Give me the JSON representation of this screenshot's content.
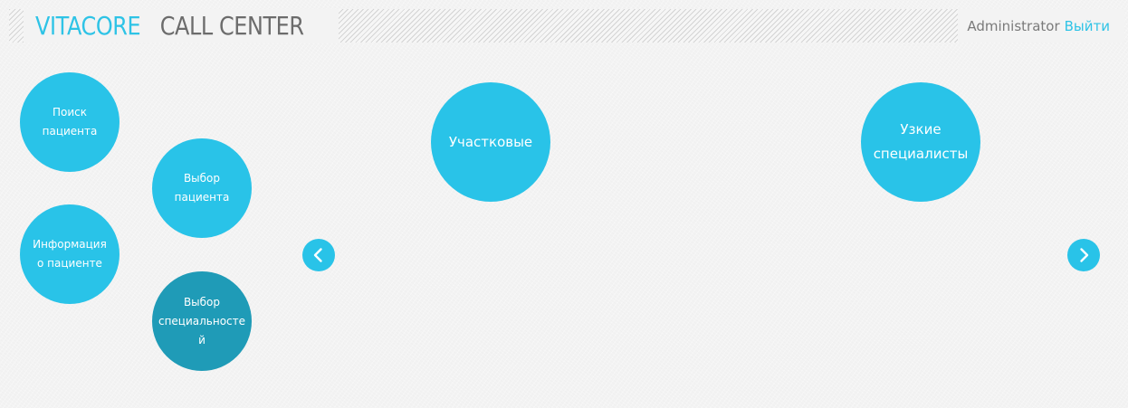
{
  "header": {
    "logo_accent": "VITACORE",
    "logo_main": "CALL CENTER",
    "user_name": "Administrator",
    "logout_label": "Выйти"
  },
  "menu": {
    "items": [
      {
        "line1": "Поиск",
        "line2": "пациента"
      },
      {
        "line1": "Выбор",
        "line2": "пациента"
      },
      {
        "line1": "Информация",
        "line2": "о пациенте"
      },
      {
        "line1": "Выбор",
        "line2": "специальносте",
        "line3": "й"
      }
    ]
  },
  "carousel": {
    "items": [
      {
        "line1": "Участковые"
      },
      {
        "line1": "Узкие",
        "line2": "специалисты"
      }
    ],
    "prev_icon": "chevron-left-icon",
    "next_icon": "chevron-right-icon"
  },
  "colors": {
    "accent": "#29c3e8",
    "active": "#1f9bb7",
    "logo_accent": "#2ec3e6",
    "logo_main": "#6c6c6c"
  }
}
